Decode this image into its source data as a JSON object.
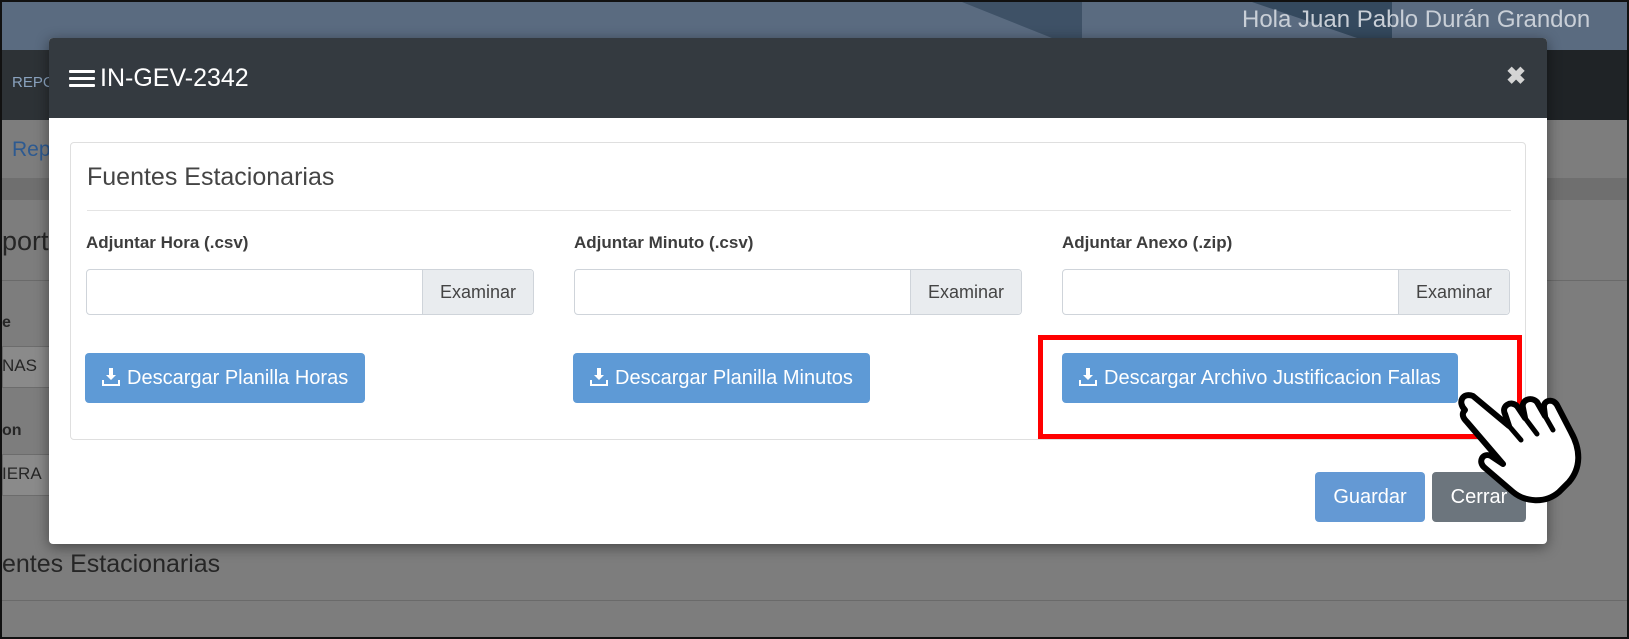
{
  "background": {
    "greeting": "Hola Juan Pablo Durán Grandon",
    "nav_text": "REPC",
    "breadcrumb": "Rep",
    "heading": "port",
    "label_1": "e",
    "field_1": "NAS",
    "label_2": "on",
    "field_2": "IERA",
    "section_title": "entes Estacionarias"
  },
  "modal": {
    "title": "IN-GEV-2342",
    "menu_icon": "bars-icon",
    "close_icon": "close-icon",
    "card_title": "Fuentes Estacionarias",
    "uploads": [
      {
        "label": "Adjuntar Hora (.csv)",
        "value": "",
        "browse_label": "Examinar"
      },
      {
        "label": "Adjuntar Minuto (.csv)",
        "value": "",
        "browse_label": "Examinar"
      },
      {
        "label": "Adjuntar Anexo (.zip)",
        "value": "",
        "browse_label": "Examinar"
      }
    ],
    "downloads": [
      {
        "label": "Descargar Planilla Horas",
        "icon": "download-icon"
      },
      {
        "label": "Descargar Planilla Minutos",
        "icon": "download-icon"
      },
      {
        "label": "Descargar Archivo Justificacion Fallas",
        "icon": "download-icon"
      }
    ],
    "footer": {
      "save_label": "Guardar",
      "close_label": "Cerrar"
    }
  },
  "colors": {
    "header_bg": "#343a40",
    "primary": "#5e9ad6",
    "secondary": "#6c757d",
    "highlight": "#ff0000"
  }
}
